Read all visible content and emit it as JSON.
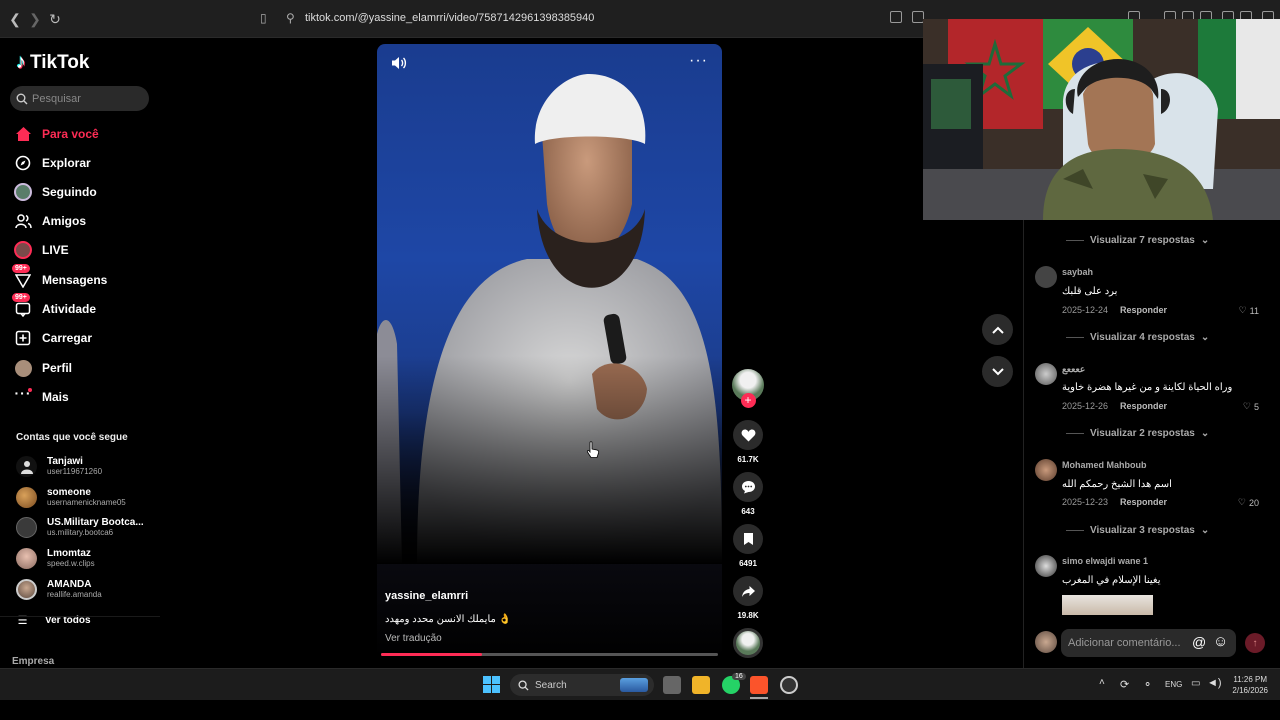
{
  "browser": {
    "url": "tiktok.com/@yassine_elamrri/video/7587142961398385940"
  },
  "app": {
    "logo_text": "TikTok"
  },
  "search": {
    "placeholder": "Pesquisar"
  },
  "nav": [
    {
      "label": "Para você",
      "icon": "home-icon",
      "active": true
    },
    {
      "label": "Explorar",
      "icon": "compass-icon"
    },
    {
      "label": "Seguindo",
      "icon": "following-avatar-icon"
    },
    {
      "label": "Amigos",
      "icon": "friends-icon"
    },
    {
      "label": "LIVE",
      "icon": "live-icon"
    },
    {
      "label": "Mensagens",
      "icon": "messages-icon",
      "badge": "99+"
    },
    {
      "label": "Atividade",
      "icon": "activity-icon",
      "badge": "99+"
    },
    {
      "label": "Carregar",
      "icon": "upload-icon"
    },
    {
      "label": "Perfil",
      "icon": "profile-icon"
    },
    {
      "label": "Mais",
      "icon": "more-icon"
    }
  ],
  "following": {
    "title": "Contas que você segue",
    "accounts": [
      {
        "name": "Tanjawi",
        "username": "user119671260"
      },
      {
        "name": "someone",
        "username": "usernamenickname05"
      },
      {
        "name": "US.Military Bootca...",
        "username": "us.military.bootca6"
      },
      {
        "name": "Lmomtaz",
        "username": "speed.w.clips"
      },
      {
        "name": "AMANDA",
        "username": "reallife.amanda"
      }
    ],
    "see_all": "Ver todos"
  },
  "footer_label": "Empresa",
  "video": {
    "author": "yassine_elamrri",
    "caption": "مايملك الانسن محدد ومهدد 👌",
    "translate": "Ver tradução",
    "progress": 0.3
  },
  "actions": {
    "likes": "61.7K",
    "comments": "643",
    "saves": "6491",
    "shares": "19.8K"
  },
  "comments": {
    "view_replies": [
      "Visualizar 7 respostas",
      "Visualizar 4 respostas",
      "Visualizar 2 respostas",
      "Visualizar 3 respostas"
    ],
    "reply_label": "Responder",
    "items": [
      {
        "user": "saybah",
        "text": "برد على قلبك",
        "date": "2025-12-24",
        "likes": "11"
      },
      {
        "user": "ععععع",
        "text": "وراه الحياة لكاينة و من غيرها هضرة خاوية",
        "date": "2025-12-26",
        "likes": "5"
      },
      {
        "user": "Mohamed Mahboub",
        "text": "اسم هدا الشيخ رحمكم الله",
        "date": "2025-12-23",
        "likes": "20"
      },
      {
        "user": "simo elwajdi wane 1",
        "text": "يغينا الإسلام في المغرب"
      }
    ],
    "input_placeholder": "Adicionar comentário..."
  },
  "taskbar": {
    "search": "Search",
    "lang": "ENG",
    "time": "11:26 PM",
    "date": "2/16/2026",
    "whatsapp_badge": "16"
  }
}
